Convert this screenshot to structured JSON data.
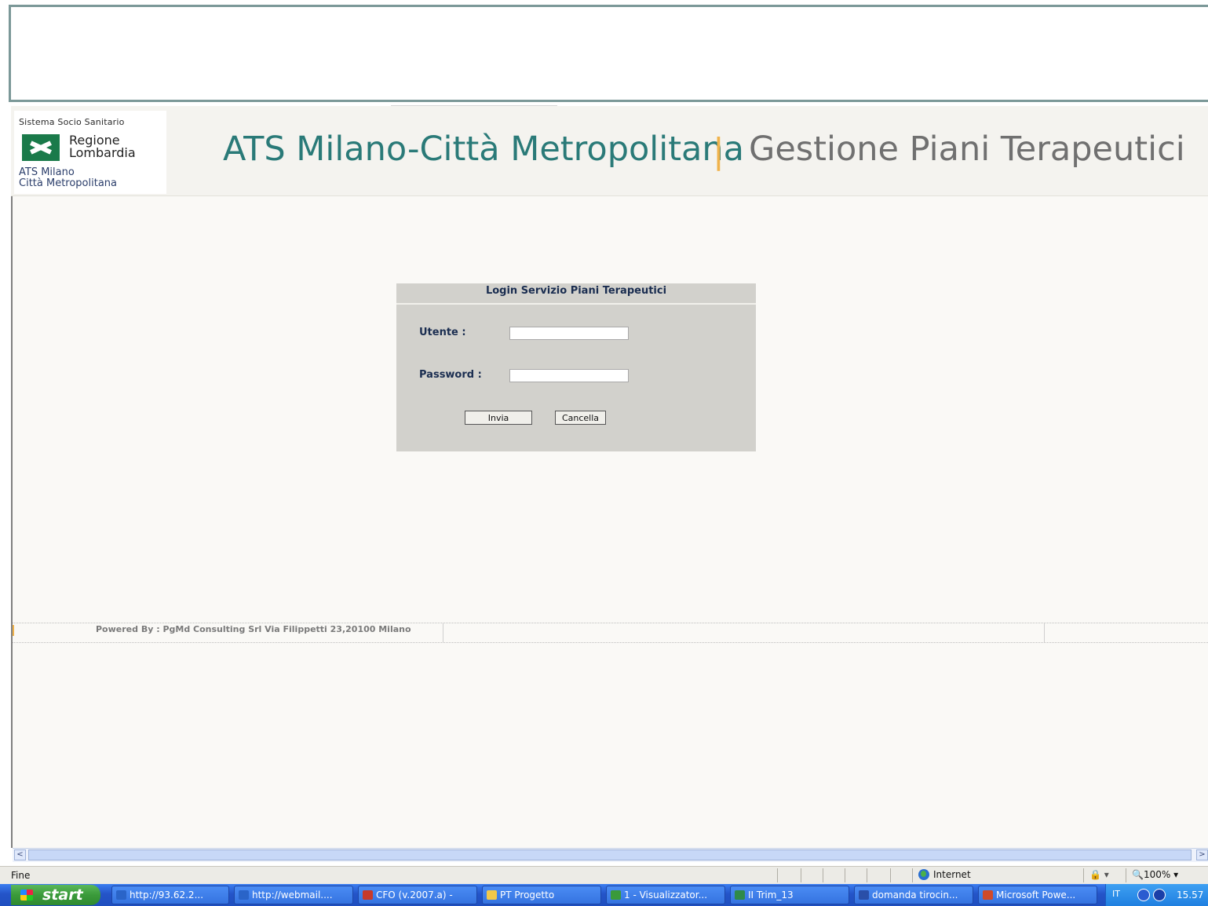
{
  "header": {
    "logo_top": "Sistema Socio Sanitario",
    "logo_name_line1": "Regione",
    "logo_name_line2": "Lombardia",
    "logo_sub_line1": "ATS Milano",
    "logo_sub_line2": "Città Metropolitana",
    "title": "ATS Milano-Città Metropolitana",
    "separator": "|",
    "subtitle": "Gestione Piani Terapeutici"
  },
  "login": {
    "title": "Login Servizio Piani Terapeutici",
    "user_label": "Utente :",
    "user_value": "",
    "password_label": "Password :",
    "password_value": "",
    "submit_label": "Invia",
    "cancel_label": "Cancella"
  },
  "footer": {
    "powered_by": "Powered By : PgMd Consulting Srl Via Filippetti 23,20100 Milano"
  },
  "scrollbar": {
    "left_arrow": "<",
    "right_arrow": ">"
  },
  "statusbar": {
    "status": "Fine",
    "zone": "Internet",
    "lock": "🔒 ▾",
    "zoom": "🔍100%  ▾"
  },
  "taskbar": {
    "start_label": "start",
    "tasks": [
      {
        "label": "http://93.62.2...",
        "icon_color": "#2a64c8"
      },
      {
        "label": "http://webmail....",
        "icon_color": "#2a64c8"
      },
      {
        "label": "CFO (v.2007.a) -",
        "icon_color": "#c83a2a"
      },
      {
        "label": "PT Progetto",
        "icon_color": "#f2c84a"
      },
      {
        "label": "1 - Visualizzator...",
        "icon_color": "#3a9a3a"
      },
      {
        "label": "II Trim_13",
        "icon_color": "#2f8a4a"
      },
      {
        "label": "domanda tirocin...",
        "icon_color": "#2a4fa8"
      },
      {
        "label": "Microsoft Powe...",
        "icon_color": "#d04a2a"
      }
    ],
    "tray_lang": "IT",
    "clock": "15.57"
  },
  "colors": {
    "title_teal": "#2a7a78",
    "subtitle_gray": "#707070",
    "separator_orange": "#f0b24a",
    "panel_gray": "#d2d1cc",
    "label_navy": "#1a2d50"
  }
}
